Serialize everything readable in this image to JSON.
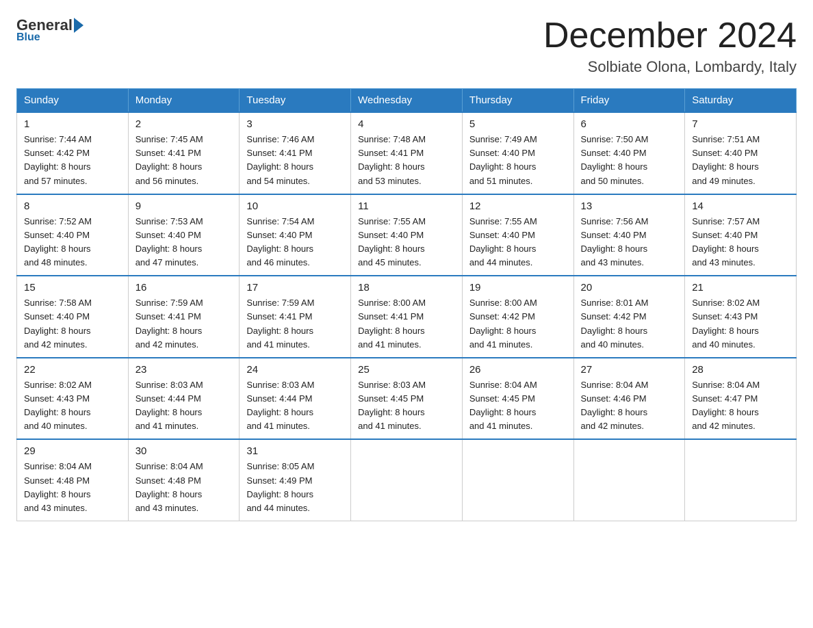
{
  "header": {
    "logo_general": "General",
    "logo_blue": "Blue",
    "month_title": "December 2024",
    "location": "Solbiate Olona, Lombardy, Italy"
  },
  "days_of_week": [
    "Sunday",
    "Monday",
    "Tuesday",
    "Wednesday",
    "Thursday",
    "Friday",
    "Saturday"
  ],
  "weeks": [
    [
      {
        "day": "1",
        "sunrise": "7:44 AM",
        "sunset": "4:42 PM",
        "daylight": "8 hours and 57 minutes."
      },
      {
        "day": "2",
        "sunrise": "7:45 AM",
        "sunset": "4:41 PM",
        "daylight": "8 hours and 56 minutes."
      },
      {
        "day": "3",
        "sunrise": "7:46 AM",
        "sunset": "4:41 PM",
        "daylight": "8 hours and 54 minutes."
      },
      {
        "day": "4",
        "sunrise": "7:48 AM",
        "sunset": "4:41 PM",
        "daylight": "8 hours and 53 minutes."
      },
      {
        "day": "5",
        "sunrise": "7:49 AM",
        "sunset": "4:40 PM",
        "daylight": "8 hours and 51 minutes."
      },
      {
        "day": "6",
        "sunrise": "7:50 AM",
        "sunset": "4:40 PM",
        "daylight": "8 hours and 50 minutes."
      },
      {
        "day": "7",
        "sunrise": "7:51 AM",
        "sunset": "4:40 PM",
        "daylight": "8 hours and 49 minutes."
      }
    ],
    [
      {
        "day": "8",
        "sunrise": "7:52 AM",
        "sunset": "4:40 PM",
        "daylight": "8 hours and 48 minutes."
      },
      {
        "day": "9",
        "sunrise": "7:53 AM",
        "sunset": "4:40 PM",
        "daylight": "8 hours and 47 minutes."
      },
      {
        "day": "10",
        "sunrise": "7:54 AM",
        "sunset": "4:40 PM",
        "daylight": "8 hours and 46 minutes."
      },
      {
        "day": "11",
        "sunrise": "7:55 AM",
        "sunset": "4:40 PM",
        "daylight": "8 hours and 45 minutes."
      },
      {
        "day": "12",
        "sunrise": "7:55 AM",
        "sunset": "4:40 PM",
        "daylight": "8 hours and 44 minutes."
      },
      {
        "day": "13",
        "sunrise": "7:56 AM",
        "sunset": "4:40 PM",
        "daylight": "8 hours and 43 minutes."
      },
      {
        "day": "14",
        "sunrise": "7:57 AM",
        "sunset": "4:40 PM",
        "daylight": "8 hours and 43 minutes."
      }
    ],
    [
      {
        "day": "15",
        "sunrise": "7:58 AM",
        "sunset": "4:40 PM",
        "daylight": "8 hours and 42 minutes."
      },
      {
        "day": "16",
        "sunrise": "7:59 AM",
        "sunset": "4:41 PM",
        "daylight": "8 hours and 42 minutes."
      },
      {
        "day": "17",
        "sunrise": "7:59 AM",
        "sunset": "4:41 PM",
        "daylight": "8 hours and 41 minutes."
      },
      {
        "day": "18",
        "sunrise": "8:00 AM",
        "sunset": "4:41 PM",
        "daylight": "8 hours and 41 minutes."
      },
      {
        "day": "19",
        "sunrise": "8:00 AM",
        "sunset": "4:42 PM",
        "daylight": "8 hours and 41 minutes."
      },
      {
        "day": "20",
        "sunrise": "8:01 AM",
        "sunset": "4:42 PM",
        "daylight": "8 hours and 40 minutes."
      },
      {
        "day": "21",
        "sunrise": "8:02 AM",
        "sunset": "4:43 PM",
        "daylight": "8 hours and 40 minutes."
      }
    ],
    [
      {
        "day": "22",
        "sunrise": "8:02 AM",
        "sunset": "4:43 PM",
        "daylight": "8 hours and 40 minutes."
      },
      {
        "day": "23",
        "sunrise": "8:03 AM",
        "sunset": "4:44 PM",
        "daylight": "8 hours and 41 minutes."
      },
      {
        "day": "24",
        "sunrise": "8:03 AM",
        "sunset": "4:44 PM",
        "daylight": "8 hours and 41 minutes."
      },
      {
        "day": "25",
        "sunrise": "8:03 AM",
        "sunset": "4:45 PM",
        "daylight": "8 hours and 41 minutes."
      },
      {
        "day": "26",
        "sunrise": "8:04 AM",
        "sunset": "4:45 PM",
        "daylight": "8 hours and 41 minutes."
      },
      {
        "day": "27",
        "sunrise": "8:04 AM",
        "sunset": "4:46 PM",
        "daylight": "8 hours and 42 minutes."
      },
      {
        "day": "28",
        "sunrise": "8:04 AM",
        "sunset": "4:47 PM",
        "daylight": "8 hours and 42 minutes."
      }
    ],
    [
      {
        "day": "29",
        "sunrise": "8:04 AM",
        "sunset": "4:48 PM",
        "daylight": "8 hours and 43 minutes."
      },
      {
        "day": "30",
        "sunrise": "8:04 AM",
        "sunset": "4:48 PM",
        "daylight": "8 hours and 43 minutes."
      },
      {
        "day": "31",
        "sunrise": "8:05 AM",
        "sunset": "4:49 PM",
        "daylight": "8 hours and 44 minutes."
      },
      null,
      null,
      null,
      null
    ]
  ],
  "labels": {
    "sunrise_prefix": "Sunrise: ",
    "sunset_prefix": "Sunset: ",
    "daylight_prefix": "Daylight: "
  }
}
